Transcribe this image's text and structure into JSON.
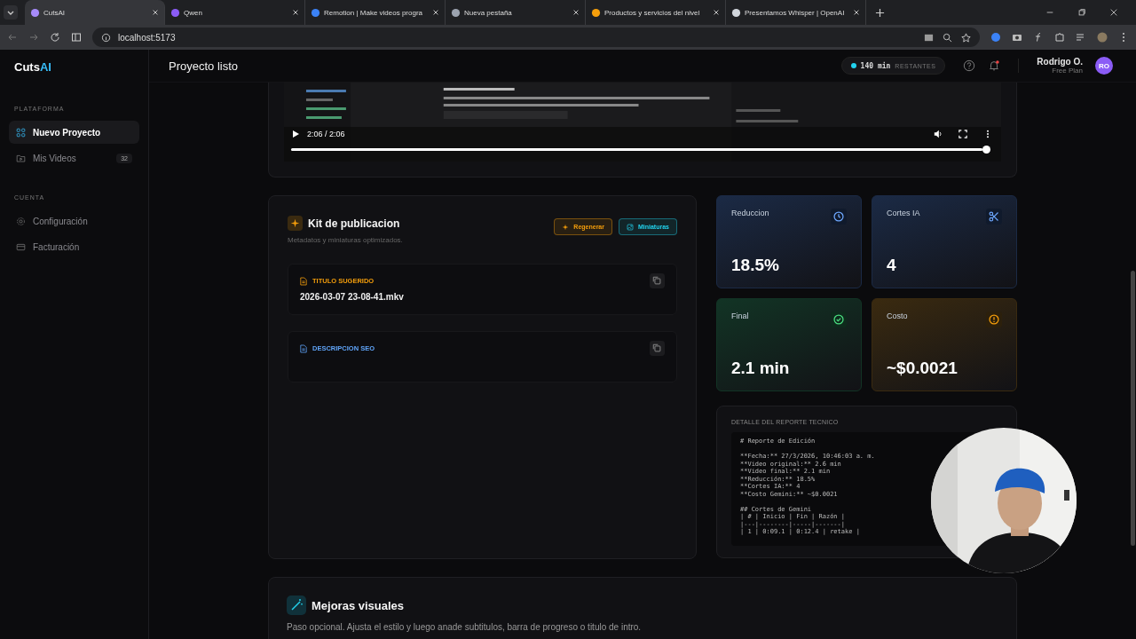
{
  "browser": {
    "tabs": [
      {
        "title": "CutsAI",
        "selected": true
      },
      {
        "title": "Qwen",
        "selected": false
      },
      {
        "title": "Remotion | Make videos progra",
        "selected": false
      },
      {
        "title": "Nueva pestaña",
        "selected": false
      },
      {
        "title": "Productos y servicios del nivel",
        "selected": false
      },
      {
        "title": "Presentamos Whisper | OpenAI",
        "selected": false
      }
    ],
    "address": "localhost:5173"
  },
  "logo": {
    "text": "Cuts",
    "accent": "AI"
  },
  "sidebar": {
    "sections": [
      {
        "heading": "PLATAFORMA",
        "items": [
          {
            "label": "Nuevo Proyecto",
            "selected": true
          },
          {
            "label": "Mis Videos",
            "selected": false,
            "badge": "32"
          }
        ]
      },
      {
        "heading": "CUENTA",
        "items": [
          {
            "label": "Configuración",
            "selected": false
          },
          {
            "label": "Facturación",
            "selected": false
          }
        ]
      }
    ]
  },
  "header": {
    "title": "Proyecto listo",
    "credits": {
      "amount": "140 min",
      "label": "RESTANTES"
    },
    "notification": true,
    "user": {
      "name": "Rodrigo O.",
      "plan": "Free Plan",
      "initials": "RO"
    }
  },
  "video": {
    "time": "2:06 / 2:06",
    "level": 1.0
  },
  "kit": {
    "title": "Kit de publicacion",
    "subtitle": "Metadatos y miniaturas optimizados.",
    "buttons": [
      {
        "label": "Regenerar",
        "color": "#f59e0b"
      },
      {
        "label": "Miniaturas",
        "color": "#22d3ee"
      }
    ],
    "fields": [
      {
        "label": "TITULO SUGERIDO",
        "value": "2026-03-07 23-08-41.mkv",
        "color": "#f59e0b"
      },
      {
        "label": "DESCRIPCION SEO",
        "color": "#60a5fa"
      }
    ]
  },
  "stats": [
    {
      "label": "Reduccion",
      "value": "18.5%",
      "color": "#1b2a45"
    },
    {
      "label": "Cortes IA",
      "value": "4",
      "color": "#1b2a45"
    },
    {
      "label": "Final",
      "value": "2.1 min",
      "color": "#123425"
    },
    {
      "label": "Costo",
      "value": "~$0.0021",
      "color": "#3a2a10"
    }
  ],
  "report": {
    "title": "DETALLE DEL REPORTE TECNICO",
    "lines": [
      "# Reporte de Edición",
      "**Fecha:** 27/3/2026, 10:46:03 a. m.",
      "**Video original:** 2.6 min",
      "**Video final:** 2.1 min",
      "**Reducción:** 18.5%",
      "**Cortes IA:** 4",
      "**Costo Gemini:** ~$0.0021",
      "## Cortes de Gemini",
      "| # | Inicio | Fin | Razón |",
      "|---|--------|-----|-------|",
      "| 1 | 0:09.1 | 0:12.4 | retake |"
    ]
  },
  "mejoras": {
    "title": "Mejoras visuales",
    "description": "Paso opcional. Ajusta el estilo y luego anade subtitulos, barra de progreso o titulo de intro."
  }
}
